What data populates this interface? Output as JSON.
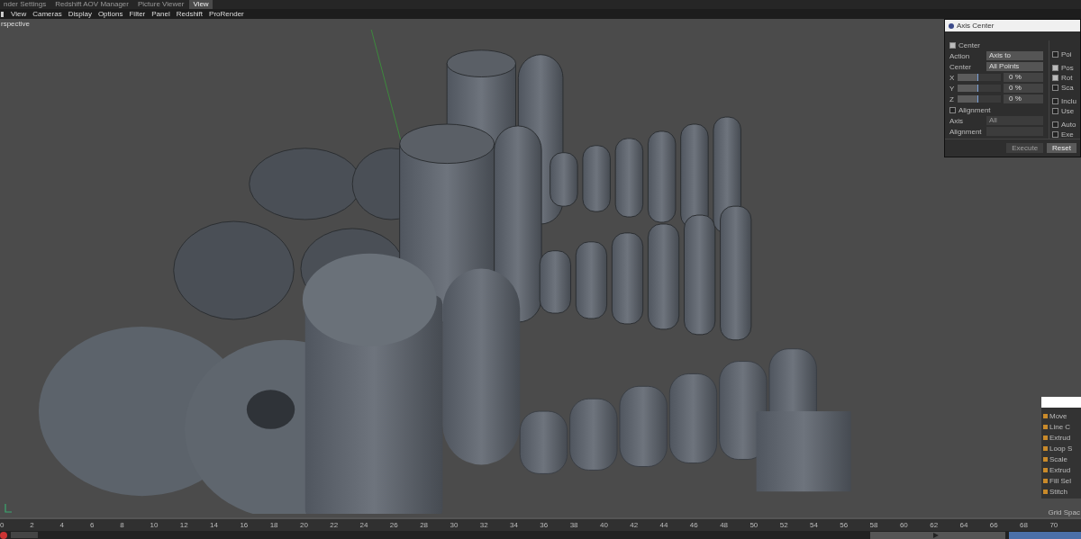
{
  "tabs": [
    {
      "label": "nder Settings",
      "selected": false
    },
    {
      "label": "Redshift AOV Manager",
      "selected": false
    },
    {
      "label": "Picture Viewer",
      "selected": false
    },
    {
      "label": "View",
      "selected": true
    }
  ],
  "menu": [
    "View",
    "Cameras",
    "Display",
    "Options",
    "Filter",
    "Panel",
    "Redshift",
    "ProRender"
  ],
  "viewport": {
    "label": "rspective"
  },
  "dialog": {
    "title": "Axis Center",
    "center": {
      "label": "Center",
      "checked": true
    },
    "fields": [
      {
        "label": "Action",
        "value": "Axis to"
      },
      {
        "label": "Center",
        "value": "All Points"
      }
    ],
    "sliders": [
      {
        "label": "X",
        "level": 0.45,
        "reading": "0 %"
      },
      {
        "label": "Y",
        "level": 0.45,
        "reading": "0 %"
      },
      {
        "label": "Z",
        "level": 0.45,
        "reading": "0 %"
      }
    ],
    "alignment": {
      "label": "Alignment",
      "checked": false
    },
    "disabled_fields": [
      {
        "label": "Axis",
        "value": "All"
      },
      {
        "label": "Alignment"
      }
    ],
    "options": [
      {
        "label": "Poi",
        "checked": false
      },
      {
        "label": "Pos",
        "checked": true
      },
      {
        "label": "Rot",
        "checked": true
      },
      {
        "label": "Sca",
        "checked": false
      },
      {
        "label": "Inclu",
        "checked": false
      },
      {
        "label": "Use",
        "checked": false
      },
      {
        "label": "Auto",
        "checked": false
      },
      {
        "label": "Exe",
        "checked": false
      }
    ],
    "buttons": [
      {
        "label": "Execute",
        "disabled": true
      },
      {
        "label": "Reset",
        "disabled": false
      }
    ]
  },
  "tool_menu": {
    "items": [
      "Move",
      "Line C",
      "Extrud",
      "Loop S",
      "Scale",
      "Extrud",
      "Fill Sel",
      "Stitch"
    ],
    "footer": "Grid Spac"
  },
  "timeline": {
    "ticks": [
      "0",
      "2",
      "4",
      "6",
      "8",
      "10",
      "12",
      "14",
      "16",
      "18",
      "20",
      "22",
      "24",
      "26",
      "28",
      "30",
      "32",
      "34",
      "36",
      "38",
      "40",
      "42",
      "44",
      "46",
      "48",
      "50",
      "52",
      "54",
      "56",
      "58",
      "60",
      "62",
      "64",
      "66",
      "68",
      "70"
    ]
  }
}
